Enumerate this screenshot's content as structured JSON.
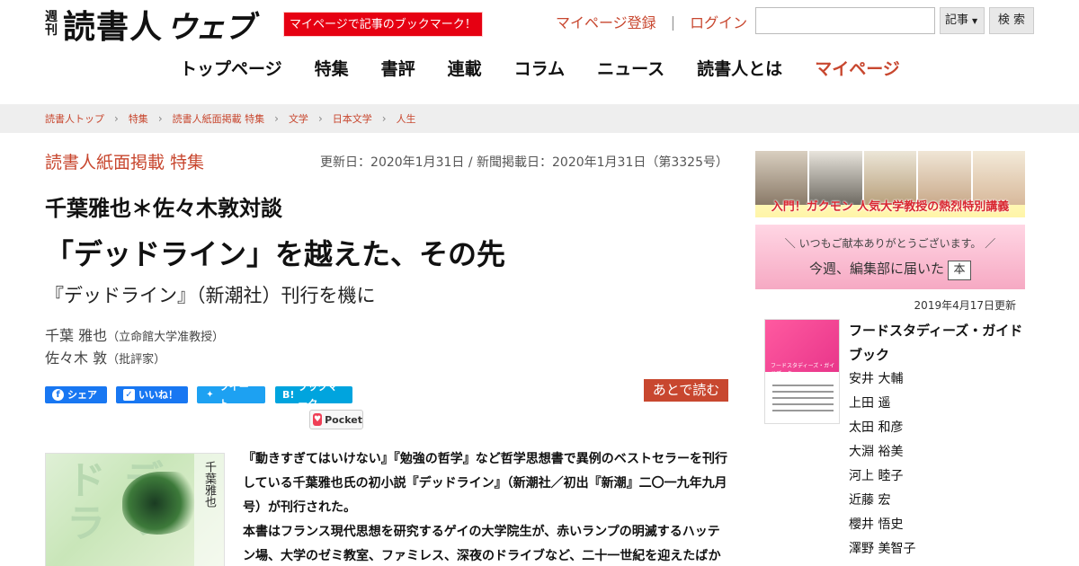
{
  "header": {
    "logo_shukan": [
      "週",
      "刊"
    ],
    "logo_main": "読書人",
    "logo_web": "ウェブ",
    "promo_badge": "マイページで記事のブックマーク！",
    "register_link": "マイページ登録",
    "separator": "|",
    "login_link": "ログイン",
    "search_placeholder": "",
    "search_scope": "記事",
    "search_button": "検 索"
  },
  "nav": {
    "items": [
      "トップページ",
      "特集",
      "書評",
      "連載",
      "コラム",
      "ニュース",
      "読書人とは",
      "マイページ"
    ]
  },
  "breadcrumb": [
    "読書人トップ",
    "特集",
    "読書人紙面掲載 特集",
    "文学",
    "日本文学",
    "人生"
  ],
  "article": {
    "category": "読書人紙面掲載 特集",
    "dates": "更新日：2020年1月31日 / 新聞掲載日：2020年1月31日（第3325号）",
    "super_title": "千葉雅也＊佐々木敦対談",
    "title": "「デッドライン」を越えた、その先",
    "subtitle": "『デッドライン』（新潮社）刊行を機に",
    "authors": [
      {
        "name": "千葉 雅也",
        "affiliation": "（立命館大学准教授）"
      },
      {
        "name": "佐々木 敦",
        "affiliation": "（批評家）"
      }
    ],
    "share": {
      "facebook": "シェア",
      "like": "いいね！",
      "twitter": "ツイート",
      "hatena": "ブックマーク",
      "hatena_mark": "B!",
      "pocket": "Pocket"
    },
    "read_later": "あとで読む",
    "cover_text": "デッドラ",
    "cover_vertical": "千葉雅也",
    "body": [
      "『動きすぎてはいけない』『勉強の哲学』など哲学思想書で異例のベストセラーを刊行している千葉雅也氏の初小説『デッドライン』（新潮社／初出『新潮』二〇一九年九月号）が刊行された。",
      "本書はフランス現代思想を研究するゲイの大学院生が、赤いランプの明滅するハッテン場、大学のゼミ教室、ファミレス、深夜のドライブなど、二十一世紀を迎えたばか"
    ]
  },
  "sidebar": {
    "banner1_caption": "入門！ガクモン 人気大学教授の熱烈特別講義",
    "banner2_line1": "＼ いつもご献本ありがとうございます。 ／",
    "banner2_line2": "今週、編集部に届いた",
    "banner2_hon": "本",
    "updated": "2019年4月17日更新",
    "book_title": "フードスタディーズ・ガイドブック",
    "book_cover_text": "フードスタディーズ・ガイドブック",
    "book_authors": [
      "安井 大輔",
      "上田 遥",
      "太田 和彦",
      "大淵 裕美",
      "河上 睦子",
      "近藤 宏",
      "櫻井 悟史",
      "澤野 美智子"
    ]
  },
  "colors": {
    "accent": "#c8472f",
    "promo": "#e60012",
    "facebook": "#1877f2",
    "twitter": "#1da1f2",
    "hatena": "#00a4de",
    "pocket": "#ef3f56"
  }
}
